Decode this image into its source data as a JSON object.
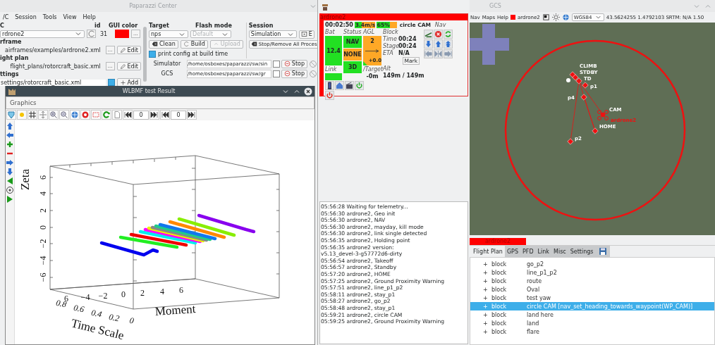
{
  "center": {
    "title": "Paparazzi Center",
    "menu": [
      "/C",
      "Session",
      "Tools",
      "View",
      "Help"
    ],
    "ac": {
      "label": "C",
      "value": "rdrone2"
    },
    "id": {
      "label": "id",
      "value": "31"
    },
    "gui_color": {
      "label": "GUI color",
      "color": "#ff0000",
      "button": "..."
    },
    "target": {
      "label": "Target",
      "value": "nps"
    },
    "flash_mode": {
      "label": "Flash mode",
      "value": "Default",
      "disabled": true
    },
    "session": {
      "label": "Session",
      "value": "Simulation",
      "button": "E"
    },
    "files": [
      {
        "kind": "edit",
        "label": "rframe",
        "path": "airframes/examples/ardrone2.xml",
        "browse": "...",
        "action": "Edit"
      },
      {
        "kind": "edit",
        "label": "ight plan",
        "path": "flight_plans/rotorcraft_basic.xml",
        "browse": "...",
        "action": "Edit"
      },
      {
        "kind": "add",
        "label": "ttings",
        "path": "settings/rotorcraft_basic.xml",
        "checked": true,
        "action": "Add"
      }
    ],
    "build_buttons": [
      {
        "label": "Clean",
        "disabled": false
      },
      {
        "label": "Build",
        "disabled": false
      },
      {
        "label": "Upload",
        "disabled": true
      }
    ],
    "print_config": {
      "label": "print config at build time",
      "checked": true
    },
    "stop_all": "Stop/Remove All Proces",
    "processes": [
      {
        "name": "Simulator",
        "command": "/home/osboxes/paparazzi/sw/sin",
        "checked": false,
        "button": "Stop"
      },
      {
        "name": "GCS",
        "command": "/home/osboxes/paparazzi/sw/gr",
        "checked": false,
        "button": "Stop"
      }
    ]
  },
  "wlbmf": {
    "title": "WLBMF test Result",
    "menu": [
      "Graphics"
    ],
    "spin_fields": [
      "0",
      "0"
    ],
    "plot": {
      "zeta_label": "Zeta",
      "zeta_ticks": [
        "6",
        "4",
        "2",
        "0",
        "−2",
        "−4",
        "−6"
      ],
      "depth_ticks": [
        "6",
        "−4",
        "−2",
        "0"
      ],
      "moment_label": "Moment",
      "moment_ticks": [
        "2",
        "4",
        "6"
      ],
      "time_label": "Time Scale",
      "time_ticks": [
        "0.8",
        "0.6",
        "0.4",
        "0.2",
        "0"
      ]
    }
  },
  "strip": {
    "name": "ardrone2",
    "flight_time": "00:02:50",
    "speed": {
      "text": "3.4m/s",
      "level": 0.35
    },
    "throttle": {
      "text": "65%",
      "level": 0.65
    },
    "block": "circle CAM",
    "nav_label": "Nav",
    "bat_label": "Bat",
    "bat": {
      "value": "12.4",
      "color": "#22e022"
    },
    "link_label": "Link",
    "link": {
      "color": "#22e022"
    },
    "status_label": "Status",
    "status": [
      {
        "text": "NAV",
        "color": "#22e022"
      },
      {
        "text": "NONE",
        "color": "#ffa826"
      },
      {
        "text": "3D",
        "color": "#22e022"
      }
    ],
    "agl_label": "AGL",
    "agl": "2",
    "climb": "+0.0",
    "block_label": "Block",
    "times": [
      {
        "label": "Time",
        "value": "00:24"
      },
      {
        "label": "Stage",
        "value": "00:24"
      },
      {
        "label": "ETA",
        "value": "N/A"
      }
    ],
    "mark": "Mark",
    "target_label": "/Target",
    "target": "-0m",
    "alt_label": "Alt",
    "alt": "149m / 149m"
  },
  "log": [
    "05:56:28 Waiting for telemetry...",
    "05:56:30 ardrone2, Geo init",
    "05:56:30 ardrone2, NAV",
    "05:56:30 ardrone2, mayday, kill mode",
    "05:56:30 ardrone2, link single detected",
    "05:56:35 ardrone2, Holding point",
    "05:56:35 ardrone2 version:",
    "v5.13_devel-3-g57772d6-dirty",
    "05:56:54 ardrone2, Takeoff",
    "05:56:57 ardrone2, Standby",
    "05:57:20 ardrone2, HOME",
    "05:57:25 ardrone2, Ground Proximity Warning",
    "05:57:51 ardrone2, line_p1_p2",
    "05:58:11 ardrone2, stay_p1",
    "05:58:27 ardrone2, go_p2",
    "05:58:48 ardrone2, stay_p1",
    "05:59:21 ardrone2, circle CAM",
    "05:59:25 ardrone2, Ground Proximity Warning"
  ],
  "gcs": {
    "title": "GCS",
    "menu": [
      "Nav",
      "Maps",
      "Help"
    ],
    "aircraft": {
      "name": "ardrone2",
      "color": "#ff0000"
    },
    "projection": "WGS84",
    "position": "43.5624255 1.4792103 SRTM: N/A 1.50",
    "map": {
      "waypoints": [
        {
          "label": "CLIMB"
        },
        {
          "label": "STDBY"
        },
        {
          "label": "TD"
        },
        {
          "label": "p1"
        },
        {
          "label": "p4"
        },
        {
          "label": "HOME"
        },
        {
          "label": "p2"
        }
      ],
      "cam_label": "CAM",
      "aircraft_label": "ardrone2"
    },
    "aircraft_tab": "ardrone2",
    "tabs": [
      {
        "label": "Flight Plan",
        "selected": true
      },
      {
        "label": "GPS",
        "selected": false
      },
      {
        "label": "PFD",
        "selected": false
      },
      {
        "label": "Link",
        "selected": false
      },
      {
        "label": "Misc",
        "selected": false
      },
      {
        "label": "Settings",
        "selected": false
      }
    ],
    "blocks": [
      {
        "expander": "+",
        "type": "block",
        "name": "go_p2",
        "selected": false
      },
      {
        "expander": "+",
        "type": "block",
        "name": "line_p1_p2",
        "selected": false
      },
      {
        "expander": "+",
        "type": "block",
        "name": "route",
        "selected": false
      },
      {
        "expander": "+",
        "type": "block",
        "name": "Oval",
        "selected": false
      },
      {
        "expander": "+",
        "type": "block",
        "name": "test yaw",
        "selected": false
      },
      {
        "expander": "+",
        "type": "block",
        "name": "circle CAM [nav_set_heading_towards_waypoint(WP_CAM)]",
        "selected": true
      },
      {
        "expander": "+",
        "type": "block",
        "name": "land here",
        "selected": false
      },
      {
        "expander": "+",
        "type": "block",
        "name": "land",
        "selected": false
      },
      {
        "expander": "+",
        "type": "block",
        "name": "flare",
        "selected": false
      }
    ]
  }
}
